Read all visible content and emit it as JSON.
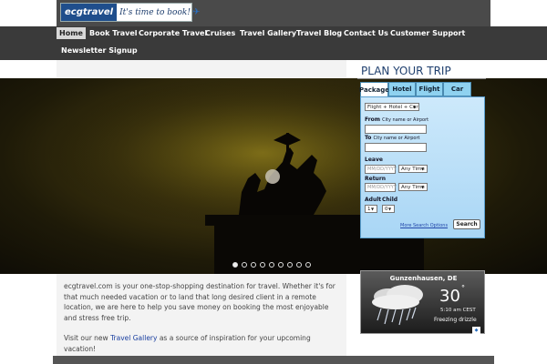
{
  "header": {
    "logo_brand": "ecgtravel",
    "logo_tagline": "It's time to book!",
    "logo_icon": "airplane-icon"
  },
  "nav": {
    "items": [
      {
        "label": "Home",
        "active": true
      },
      {
        "label": "Book Travel"
      },
      {
        "label": "Corporate Travel"
      },
      {
        "label": "Cruises"
      },
      {
        "label": "Travel Gallery"
      },
      {
        "label": "Travel Blog"
      },
      {
        "label": "Contact Us"
      },
      {
        "label": "Customer Support"
      },
      {
        "label": "Newsletter Signup"
      }
    ]
  },
  "slider": {
    "page_count": 9,
    "current": 1
  },
  "intro": {
    "p1": "ecgtravel.com is your one-stop-shopping destination for travel. Whether it's for that much needed vacation or to land that long desired client in a remote location, we are here to help you save money on booking the most enjoyable and stress free trip.",
    "p2_before": "Visit our new ",
    "p2_link": "Travel Gallery",
    "p2_after": " as a source of inspiration for your upcoming vacation!"
  },
  "plan": {
    "title": "PLAN YOUR TRIP",
    "tabs": [
      "Package",
      "Hotel",
      "Flight",
      "Car"
    ],
    "active_tab": "Package",
    "package_type": "Flight + Hotel + Car",
    "from_label": "From",
    "from_hint": "City name or Airport",
    "to_label": "To",
    "to_hint": "City name or Airport",
    "leave_label": "Leave",
    "return_label": "Return",
    "date_placeholder": "MM/DD/YYYY",
    "time_value": "Any Time",
    "adult_label": "Adult",
    "child_label": "Child",
    "adult_value": "1",
    "child_value": "0",
    "more_link": "More Search Options",
    "search_button": "Search"
  },
  "weather": {
    "city": "Gunzenhausen, DE",
    "temp": "30",
    "deg": "°",
    "time": "5:10 am CEST",
    "condition": "Freezing drizzle",
    "icon": "freezing-drizzle-icon"
  }
}
